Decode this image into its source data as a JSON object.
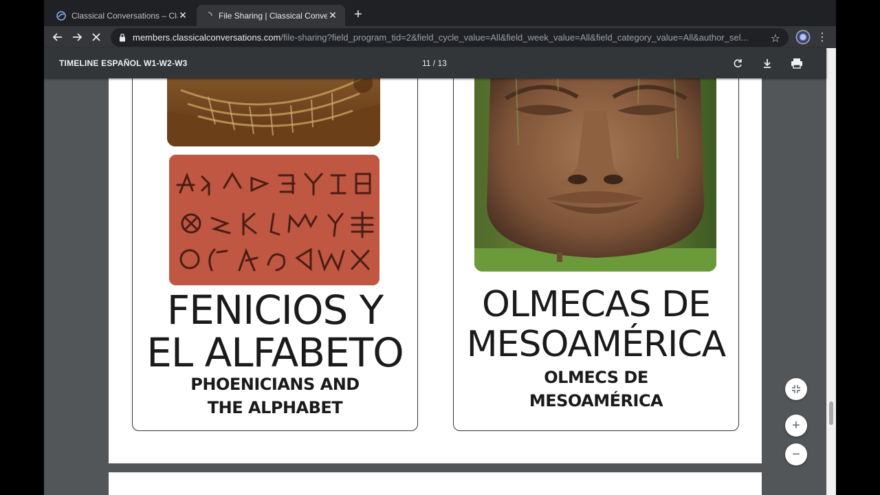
{
  "browser": {
    "tabs": [
      {
        "title": "Classical Conversations – Clas",
        "active": false
      },
      {
        "title": "File Sharing | Classical Conver",
        "active": true
      }
    ],
    "url_host": "members.classicalconversations.com",
    "url_rest": "/file-sharing?field_program_tid=2&field_cycle_value=All&field_week_value=All&field_category_value=All&author_sel..."
  },
  "pdf": {
    "title": "TIMELINE ESPAÑOL W1-W2-W3",
    "page_indicator": "11 / 13"
  },
  "cards": [
    {
      "title_line1": "FENICIOS Y",
      "title_line2": "EL ALFABETO",
      "subtitle_line1": "PHOENICIANS AND",
      "subtitle_line2": "THE ALPHABET"
    },
    {
      "title_line1": "OLMECAS DE",
      "title_line2": "MESOAMÉRICA",
      "subtitle_line1": "OLMECS DE",
      "subtitle_line2": "MESOAMÉRICA"
    }
  ],
  "colors": {
    "chrome_dark": "#202124",
    "chrome_toolbar": "#35363a",
    "pdf_toolbar": "#323639",
    "viewer_bg": "#525659",
    "tablet_red": "#c55a45"
  }
}
